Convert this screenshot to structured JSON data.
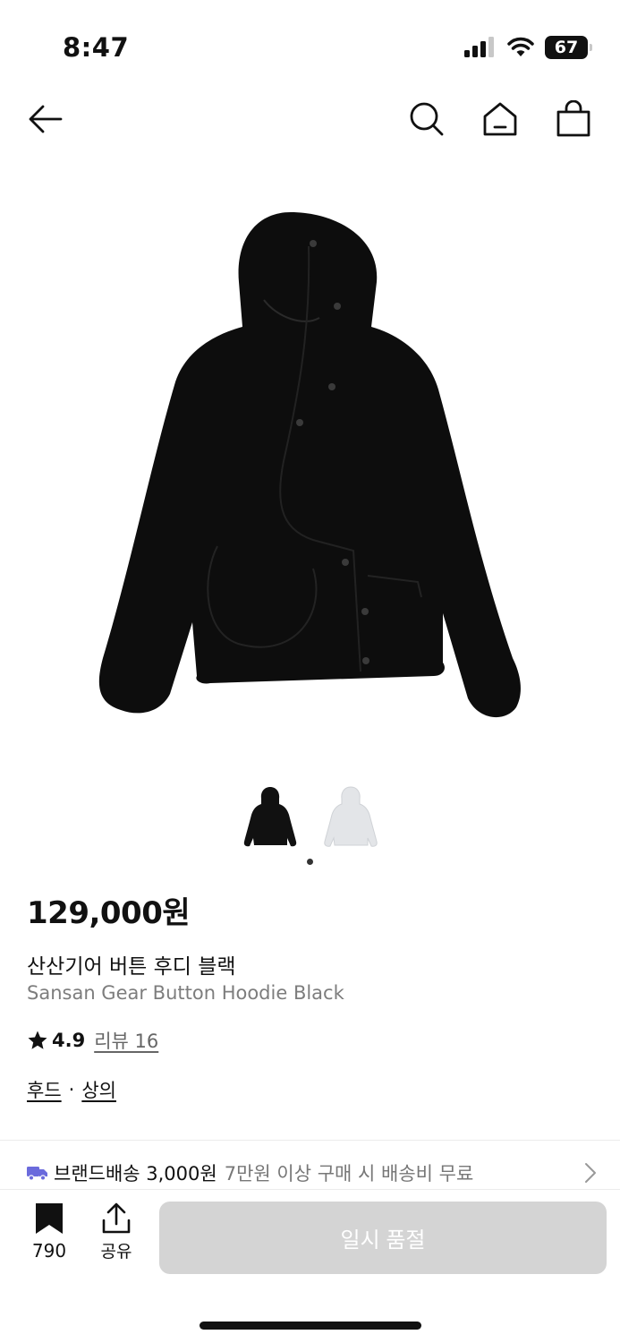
{
  "status": {
    "time": "8:47",
    "battery": "67"
  },
  "nav": {
    "back_icon": "arrow-left-icon",
    "search_icon": "search-icon",
    "home_icon": "home-icon",
    "cart_icon": "shopping-bag-icon"
  },
  "product": {
    "price": "129,000원",
    "name_ko": "산산기어 버튼 후디 블랙",
    "name_en": "Sansan Gear Button Hoodie Black",
    "rating": "4.9",
    "review_link": "리뷰 16",
    "categories": [
      "후드",
      "상의"
    ],
    "category_separator": "·"
  },
  "shipping": {
    "label": "브랜드배송 3,000원",
    "note": "7만원 이상 구매 시 배송비 무료"
  },
  "bottom": {
    "bookmark_count": "790",
    "share_label": "공유",
    "soldout_label": "일시 품절"
  },
  "colors": {
    "soldout_bg": "#d4d4d4",
    "truck": "#6b6bdc",
    "text": "#111111",
    "subtext": "#7d7d7d"
  }
}
